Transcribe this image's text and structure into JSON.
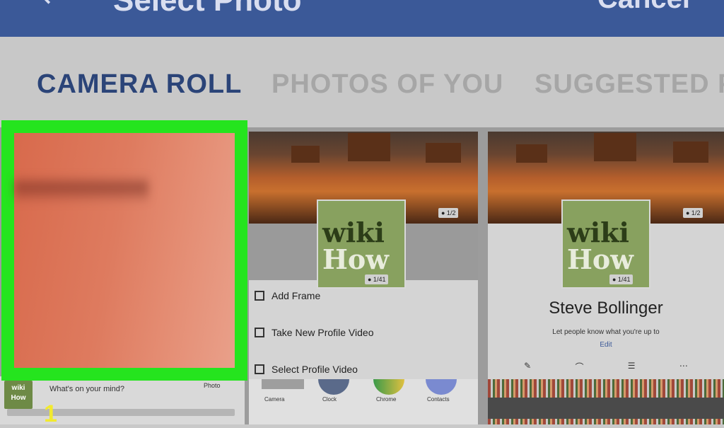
{
  "header": {
    "back_glyph": "←",
    "title": "Select Photo",
    "cancel_label": "Cancel"
  },
  "tabs": [
    {
      "label": "CAMERA ROLL",
      "active": true
    },
    {
      "label": "PHOTOS OF YOU",
      "active": false
    },
    {
      "label": "SUGGESTED PI",
      "active": false
    }
  ],
  "thumbs": {
    "profile_screenshot_1": {
      "wiki_line1": "wiki",
      "wiki_line2": "How",
      "cover_badge": "● 1/2",
      "photo_badge": "● 1/41",
      "menu": [
        "Add Frame",
        "Take New Profile Video",
        "Select Profile Video"
      ]
    },
    "profile_screenshot_2": {
      "wiki_line1": "wiki",
      "wiki_line2": "How",
      "cover_badge": "● 1/2",
      "photo_badge": "● 1/41",
      "name": "Steve Bollinger",
      "subtitle": "Let people know what you're up to",
      "link": "Edit"
    },
    "facebook_feed": {
      "avatar_text": "wiki How",
      "prompt": "What's on your mind?",
      "photo_label": "Photo"
    },
    "app_drawer": {
      "apps": [
        "Camera",
        "Clock",
        "Chrome",
        "Contacts"
      ]
    }
  },
  "step_number": "1",
  "colors": {
    "header_bg": "#3b5998",
    "selection_border": "#25e41e",
    "active_tab": "#2b4478",
    "step_number": "#f2ea2e"
  }
}
